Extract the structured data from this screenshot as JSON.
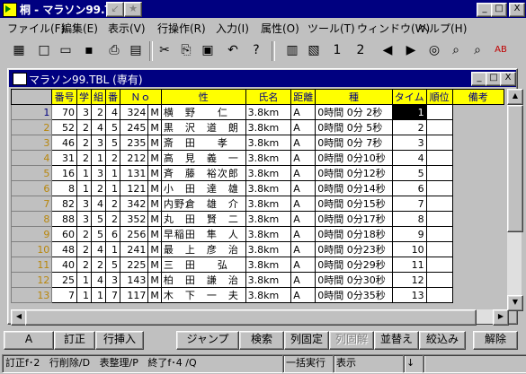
{
  "app": {
    "title": "桐 - マラソン99.TBL",
    "caption_buttons": [
      "_",
      "□",
      "X"
    ],
    "title_tool_buttons": [
      "↙",
      "★"
    ]
  },
  "menu": [
    "ファイル(F)",
    "編集(E)",
    "表示(V)",
    "行操作(R)",
    "入力(I)",
    "属性(O)",
    "ツール(T)",
    "ウィンドウ(W)",
    "ヘルプ(H)"
  ],
  "toolbar": {
    "icons": [
      "table-icon",
      "new-file-icon",
      "open-folder-icon",
      "save-icon",
      "print-icon",
      "print-preview-icon",
      "cut-icon",
      "copy-icon",
      "paste-icon",
      "undo-icon",
      "help-pointer-icon",
      "sort-icon",
      "filter-icon",
      "sort-asc-icon",
      "sort-desc-icon",
      "prev-icon",
      "next-icon",
      "search-icon",
      "zoom-icon",
      "find-icon",
      "font-icon"
    ],
    "glyphs": [
      "▦",
      "□",
      "▭",
      "▪",
      "⎙",
      "▤",
      "✂",
      "⎘",
      "▣",
      "↶",
      "?",
      "▥",
      "▧",
      "1",
      "2",
      "◀",
      "▶",
      "◎",
      "⌕",
      "⌕",
      "AB"
    ]
  },
  "child": {
    "title": "マラソン99.TBL (専有)",
    "caption_buttons": [
      "_",
      "□",
      "X"
    ]
  },
  "table": {
    "columns": [
      "番号",
      "学",
      "組",
      "番",
      "Ｎｏ",
      "性",
      "氏名",
      "距離",
      "種",
      "タイム",
      "順位",
      "備考"
    ],
    "rows": [
      [
        "1",
        "70",
        "3",
        "2",
        "4",
        "324",
        "M",
        "横　野　　仁",
        "3.8km",
        "A",
        "0時間 0分 2秒",
        "1",
        ""
      ],
      [
        "2",
        "52",
        "2",
        "4",
        "5",
        "245",
        "M",
        "黒　沢　道　朗",
        "3.8km",
        "A",
        "0時間 0分 5秒",
        "2",
        ""
      ],
      [
        "3",
        "46",
        "2",
        "3",
        "5",
        "235",
        "M",
        "斎　田　　孝",
        "3.8km",
        "A",
        "0時間 0分 7秒",
        "3",
        ""
      ],
      [
        "4",
        "31",
        "2",
        "1",
        "2",
        "212",
        "M",
        "高　見　義　一",
        "3.8km",
        "A",
        "0時間 0分10秒",
        "4",
        ""
      ],
      [
        "5",
        "16",
        "1",
        "3",
        "1",
        "131",
        "M",
        "斉　藤　裕次郎",
        "3.8km",
        "A",
        "0時間 0分12秒",
        "5",
        ""
      ],
      [
        "6",
        "8",
        "1",
        "2",
        "1",
        "121",
        "M",
        "小　田　達　雄",
        "3.8km",
        "A",
        "0時間 0分14秒",
        "6",
        ""
      ],
      [
        "7",
        "82",
        "3",
        "4",
        "2",
        "342",
        "M",
        "内野倉　雄　介",
        "3.8km",
        "A",
        "0時間 0分15秒",
        "7",
        ""
      ],
      [
        "8",
        "88",
        "3",
        "5",
        "2",
        "352",
        "M",
        "丸　田　賢　二",
        "3.8km",
        "A",
        "0時間 0分17秒",
        "8",
        ""
      ],
      [
        "9",
        "60",
        "2",
        "5",
        "6",
        "256",
        "M",
        "早稲田　隼　人",
        "3.8km",
        "A",
        "0時間 0分18秒",
        "9",
        ""
      ],
      [
        "10",
        "48",
        "2",
        "4",
        "1",
        "241",
        "M",
        "最　上　彦　治",
        "3.8km",
        "A",
        "0時間 0分23秒",
        "10",
        ""
      ],
      [
        "11",
        "40",
        "2",
        "2",
        "5",
        "225",
        "M",
        "三　田　　弘",
        "3.8km",
        "A",
        "0時間 0分29秒",
        "11",
        ""
      ],
      [
        "12",
        "25",
        "1",
        "4",
        "3",
        "143",
        "M",
        "柏　田　謙　治",
        "3.8km",
        "A",
        "0時間 0分30秒",
        "12",
        ""
      ],
      [
        "13",
        "7",
        "1",
        "1",
        "7",
        "117",
        "M",
        "木　下　一　夫",
        "3.8km",
        "A",
        "0時間 0分35秒",
        "13",
        ""
      ]
    ],
    "selected_cell": "row 1, 順位"
  },
  "function_keys": [
    "A",
    "訂正",
    "行挿入",
    "ジャンプ",
    "検索",
    "列固定",
    "列固解",
    "並替え",
    "絞込み",
    "解除"
  ],
  "status": [
    "訂正f･2",
    "行削除/D",
    "表整理/P",
    "終了f･4 /Q",
    "一括実行",
    "表示",
    "↓"
  ]
}
